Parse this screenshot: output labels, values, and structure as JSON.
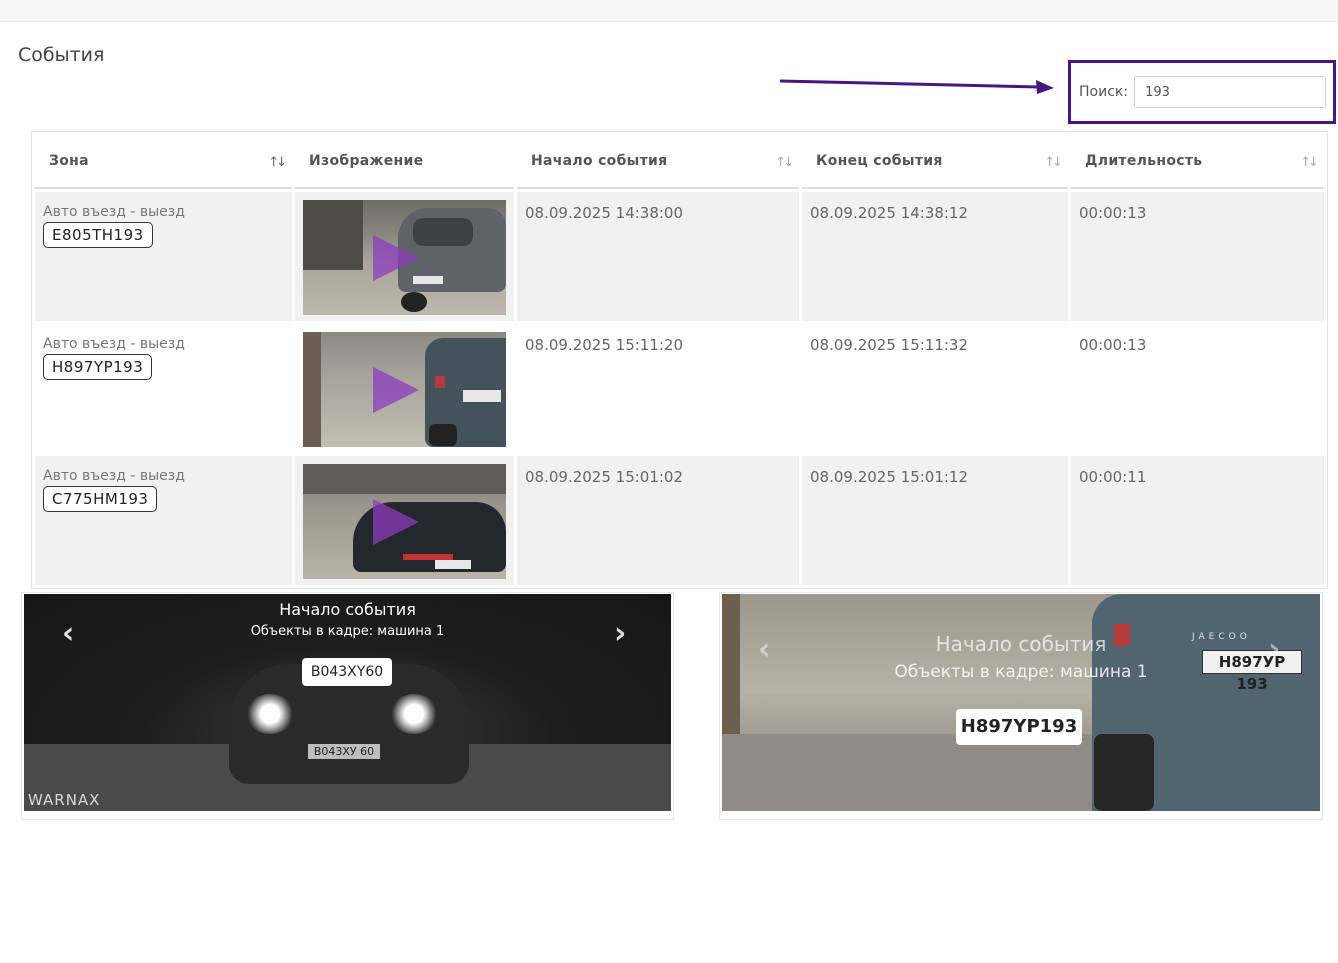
{
  "page": {
    "title": "События"
  },
  "search": {
    "label": "Поиск:",
    "value": "193"
  },
  "table": {
    "headers": [
      {
        "label": "Зона"
      },
      {
        "label": "Изображение"
      },
      {
        "label": "Начало события"
      },
      {
        "label": "Конец события"
      },
      {
        "label": "Длительность"
      }
    ],
    "rows": [
      {
        "zone": "Авто въезд - выезд",
        "plate": "E805TH193",
        "start": "08.09.2025 14:38:00",
        "end": "08.09.2025 14:38:12",
        "duration": "00:00:13"
      },
      {
        "zone": "Авто въезд - выезд",
        "plate": "H897YP193",
        "start": "08.09.2025 15:11:20",
        "end": "08.09.2025 15:11:32",
        "duration": "00:00:13"
      },
      {
        "zone": "Авто въезд - выезд",
        "plate": "C775HM193",
        "start": "08.09.2025 15:01:02",
        "end": "08.09.2025 15:01:12",
        "duration": "00:00:11"
      }
    ]
  },
  "viewer_left": {
    "title": "Начало события",
    "subtitle": "Объекты в кадре: машина 1",
    "plate_label": "B043XY60",
    "car_plate": "В043ХУ 60",
    "watermark": "WARNAX"
  },
  "viewer_right": {
    "title": "Начало события",
    "subtitle": "Объекты в кадре: машина 1",
    "plate_label": "H897YP193",
    "car_plate": "Н897УР 193",
    "car_badge": "JAECOO"
  },
  "colors": {
    "highlight": "#4b1581",
    "play": "#8c3cbe"
  }
}
